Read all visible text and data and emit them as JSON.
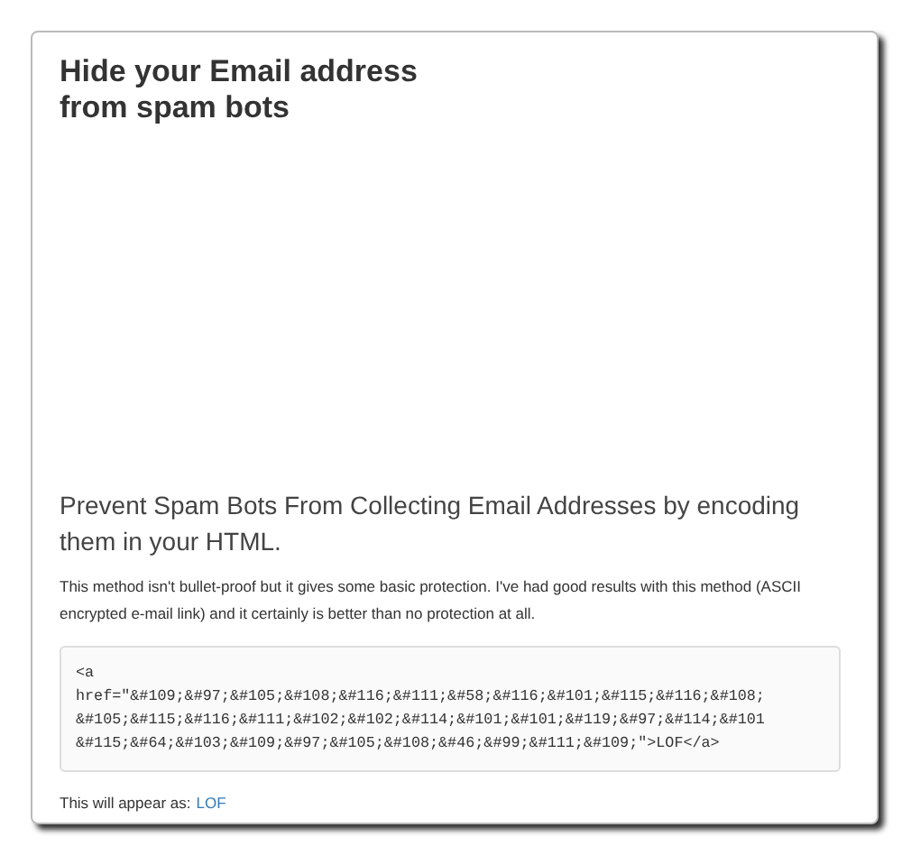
{
  "title_lines": [
    "Hide your Email address",
    "from spam bots"
  ],
  "heading": "Prevent Spam Bots From Collecting Email Addresses by encoding them in your HTML.",
  "description": "This method isn't bullet-proof but it gives some basic protection. I've had good results with this method (ASCII encrypted e-mail link) and it certainly is better than no protection at all.",
  "code_lines": [
    "<a",
    "href=\"&#109;&#97;&#105;&#108;&#116;&#111;&#58;&#116;&#101;&#115;&#116;&#108;",
    "&#105;&#115;&#116;&#111;&#102;&#102;&#114;&#101;&#101;&#119;&#97;&#114;&#101",
    "&#115;&#64;&#103;&#109;&#97;&#105;&#108;&#46;&#99;&#111;&#109;\">LOF</a>"
  ],
  "result_label": "This will appear as:",
  "result_link": "LOF"
}
